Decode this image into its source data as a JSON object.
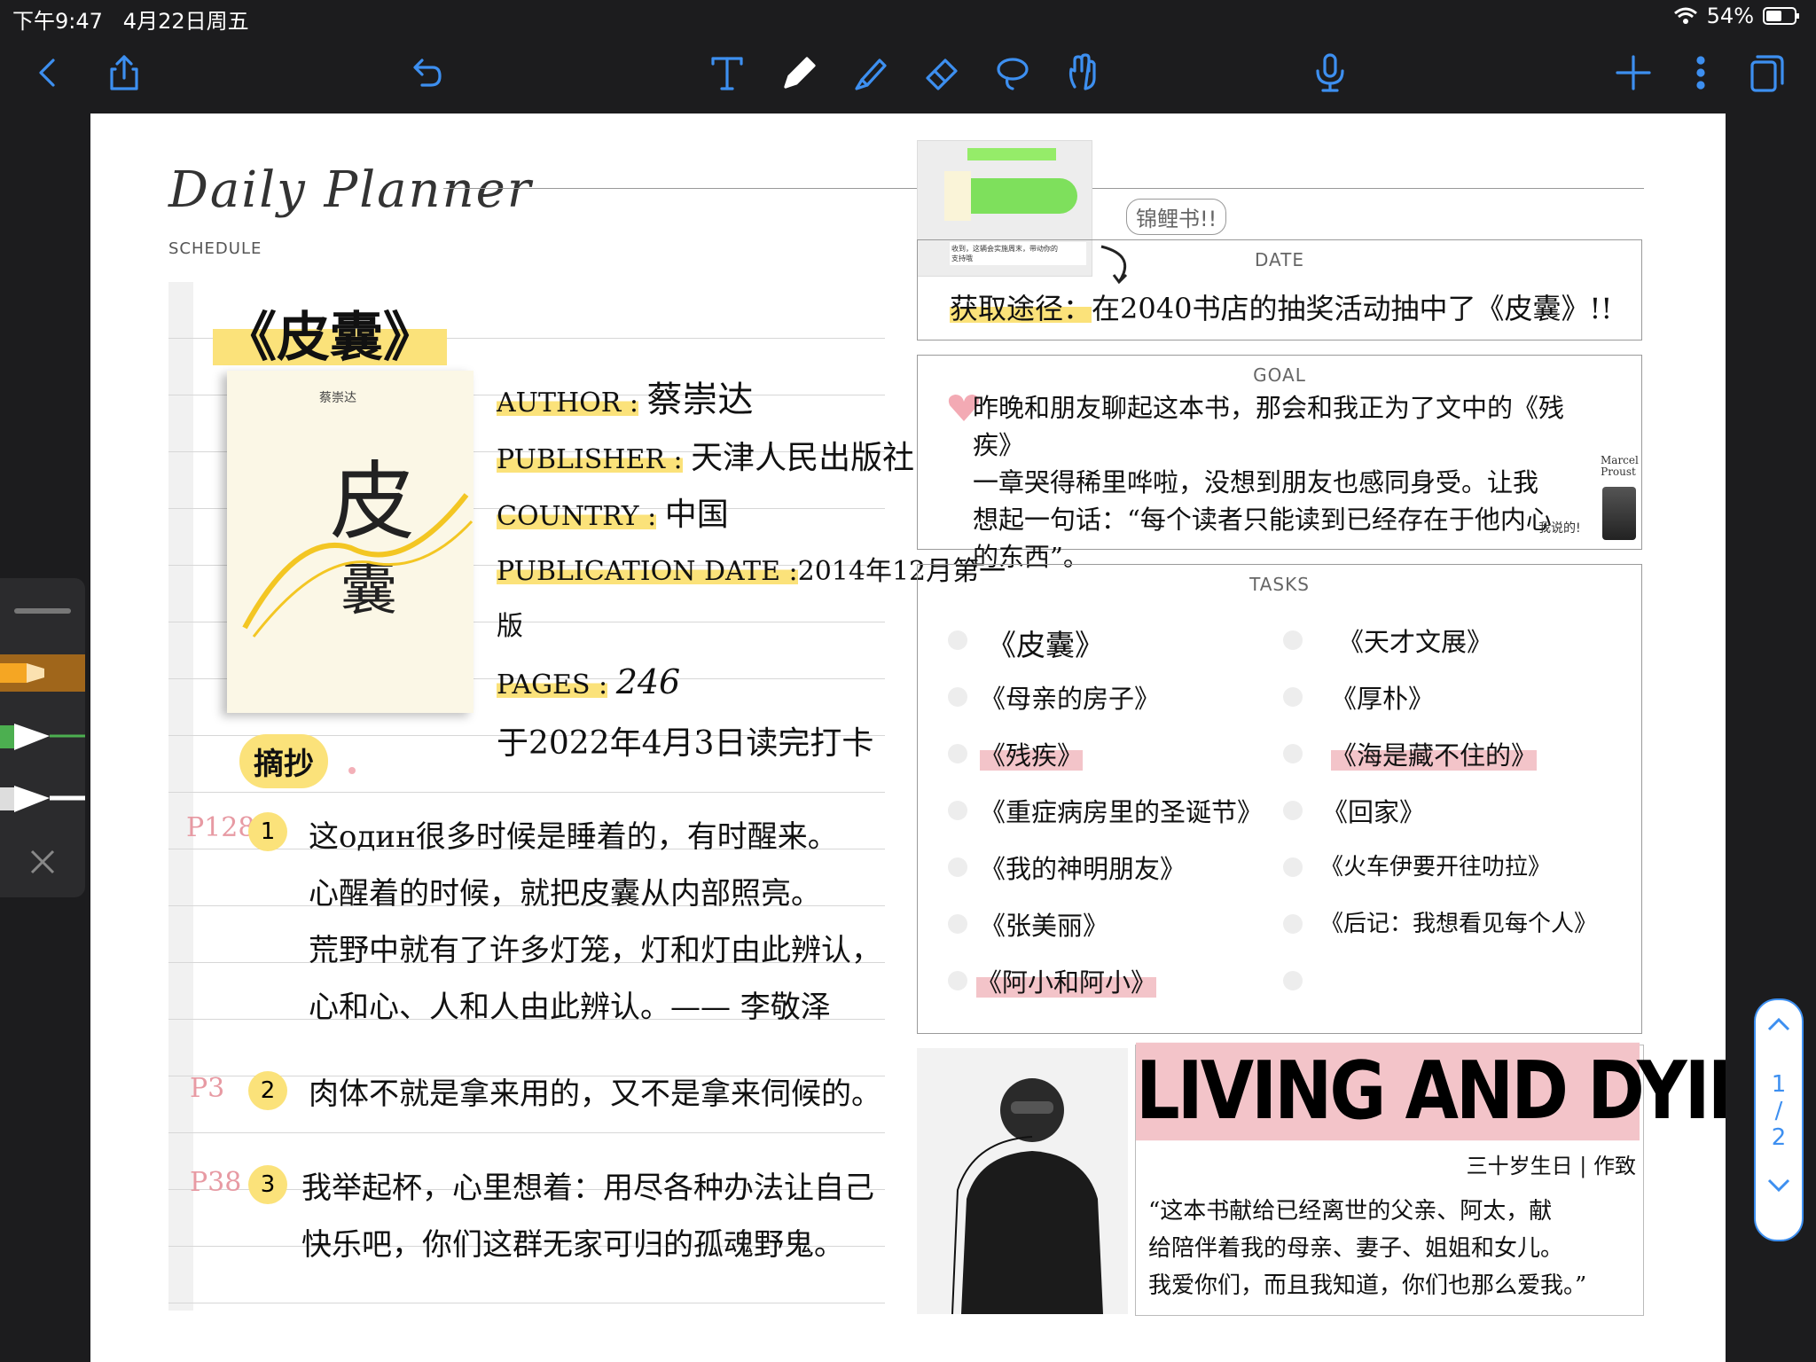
{
  "status": {
    "time": "下午9:47",
    "date": "4月22日周五",
    "battery": "54%"
  },
  "toolbar": {
    "icons": [
      "back-icon",
      "share-icon",
      "undo-icon",
      "text-tool-icon",
      "pen-icon",
      "highlighter-icon",
      "eraser-icon",
      "lasso-icon",
      "hand-icon",
      "microphone-icon",
      "add-icon",
      "more-icon",
      "pages-icon"
    ]
  },
  "planner": {
    "title": "Daily Planner",
    "schedule_label": "SCHEDULE"
  },
  "book": {
    "title": "《皮囊》",
    "cover_author": "蔡崇达",
    "cover_title_1": "皮",
    "cover_title_2": "囊",
    "author_label": "AUTHOR :",
    "author": "蔡崇达",
    "publisher_label": "PUBLISHER :",
    "publisher": "天津人民出版社",
    "country_label": "COUNTRY :",
    "country": "中国",
    "pubdate_label": "PUBLICATION DATE :",
    "pubdate": "2014年12月第一版",
    "pages_label": "PAGES :",
    "pages": "246",
    "checkin": "于2022年4月3日读完打卡"
  },
  "excerpt": {
    "label": "摘抄",
    "items": [
      {
        "page": "P128",
        "num": "1",
        "lines": [
          "这один很多时候是睡着的，有时醒来。",
          "心醒着的时候，就把皮囊从内部照亮。",
          "荒野中就有了许多灯笼，灯和灯由此辨认，",
          "心和心、人和人由此辨认。—— 李敬泽"
        ]
      },
      {
        "page": "P3",
        "num": "2",
        "lines": [
          "肉体不就是拿来用的，又不是拿来伺候的。"
        ]
      },
      {
        "page": "P38",
        "num": "3",
        "lines": [
          "我举起杯，心里想着：用尽各种办法让自己",
          "快乐吧，你们这群无家可归的孤魂野鬼。"
        ]
      }
    ]
  },
  "date_box": {
    "title": "DATE",
    "sticker": "锦鲤书!!",
    "text_label": "获取途径：",
    "text": "在2040书店的抽奖活动抽中了《皮囊》!!"
  },
  "goal_box": {
    "title": "GOAL",
    "lines": [
      "昨晚和朋友聊起这本书，那会和我正为了文中的《残疾》",
      "一章哭得稀里哗啦，没想到朋友也感同身受。让我",
      "想起一句话：“每个读者只能读到已经存在于他内心",
      "的东西”。"
    ],
    "quote_author": "Marcel Proust",
    "note": "我说的!"
  },
  "tasks_box": {
    "title": "TASKS",
    "left": [
      "《皮囊》",
      "《母亲的房子》",
      "《残疾》",
      "《重症病房里的圣诞节》",
      "《我的神明朋友》",
      "《张美丽》",
      "《阿小和阿小》",
      ""
    ],
    "right": [
      "《天才文展》",
      "《厚朴》",
      "《海是藏不住的》",
      "《回家》",
      "《火车伊要开往叻拉》",
      "《后记：我想看见每个人》",
      "",
      ""
    ]
  },
  "living": {
    "title": "LIVING AND DYING",
    "signature": "三十岁生日 | 作致",
    "quote_lines": [
      "“这本书献给已经离世的父亲、阿太，献",
      "给陪伴着我的母亲、妻子、姐姐和女儿。",
      "我爱你们，而且我知道，你们也那么爱我。”"
    ]
  },
  "chat_thumbnail": {
    "line1": "收到，这辆会实施周末，带动你的",
    "line2": "支持哦"
  },
  "pagenav": {
    "current": "1",
    "sep": "/",
    "total": "2"
  },
  "colors": {
    "accent": "#3d8ff0",
    "highlight_yellow": "#fbe27a",
    "highlight_pink": "#f3c4c9",
    "pen_orange": "#f5a623",
    "pen_green": "#4caf50"
  }
}
